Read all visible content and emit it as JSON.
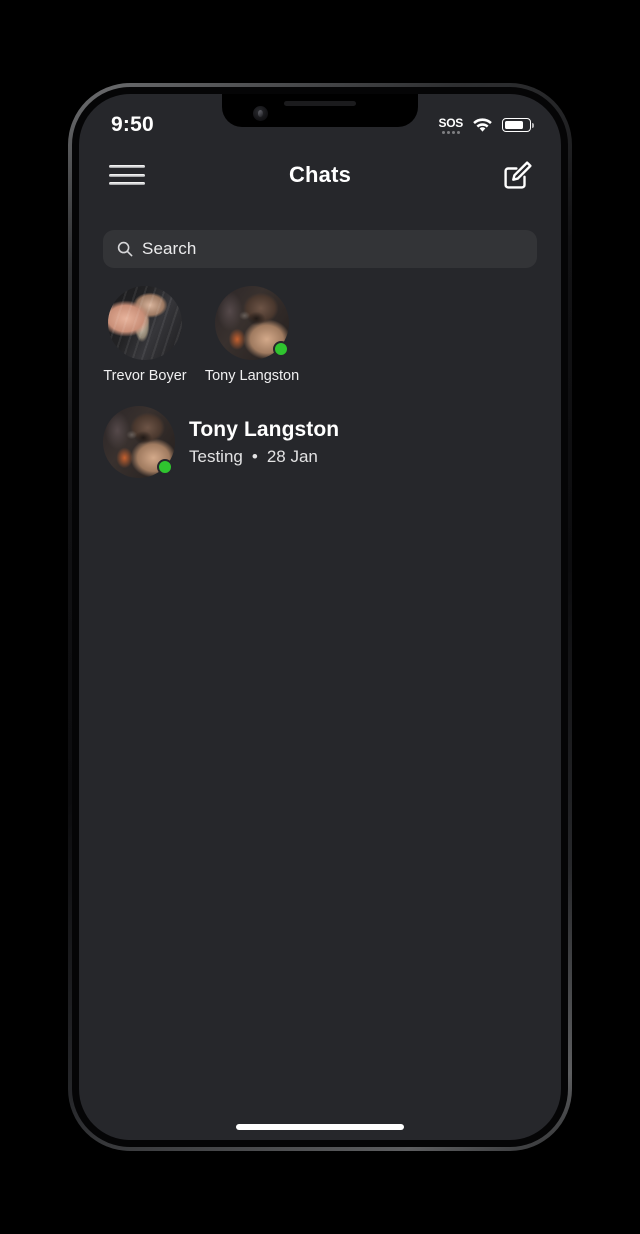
{
  "status_bar": {
    "time": "9:50",
    "cellular_label": "SOS",
    "wifi_icon": "wifi-icon",
    "battery_icon": "battery-icon",
    "battery_level_percent": 78
  },
  "header": {
    "title": "Chats",
    "menu_icon": "hamburger-menu-icon",
    "compose_icon": "compose-icon"
  },
  "search": {
    "placeholder": "Search",
    "value": "",
    "icon": "search-icon"
  },
  "stories": [
    {
      "name": "Trevor Boyer",
      "online": false,
      "avatar": "avatar-trevor-boyer"
    },
    {
      "name": "Tony Langston",
      "online": true,
      "avatar": "avatar-tony-langston"
    }
  ],
  "chats": [
    {
      "name": "Tony Langston",
      "preview": "Testing",
      "separator": "•",
      "date": "28 Jan",
      "online": true,
      "avatar": "avatar-tony-langston"
    }
  ],
  "colors": {
    "screen_background": "#26272b",
    "search_background": "#333437",
    "online_green": "#2fc42f",
    "primary_text": "#ffffff",
    "secondary_text": "#e2e2e3"
  }
}
